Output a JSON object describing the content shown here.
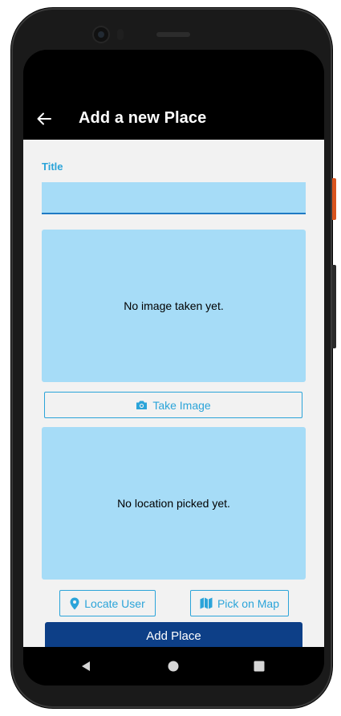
{
  "app_bar": {
    "title": "Add a new Place",
    "back_icon": "arrow-left-icon"
  },
  "form": {
    "title_label": "Title",
    "title_value": "",
    "title_placeholder": ""
  },
  "image_input": {
    "preview_text": "No image taken yet.",
    "take_image_label": "Take Image",
    "take_image_icon": "camera-icon"
  },
  "location_input": {
    "preview_text": "No location picked yet.",
    "locate_user_label": "Locate User",
    "locate_user_icon": "location-pin-icon",
    "pick_on_map_label": "Pick on Map",
    "pick_on_map_icon": "map-icon"
  },
  "submit": {
    "label": "Add Place"
  },
  "system_nav": {
    "back_icon": "nav-back-triangle-icon",
    "home_icon": "nav-home-circle-icon",
    "recents_icon": "nav-recents-square-icon"
  },
  "colors": {
    "accent": "#2ba4d9",
    "input_fill": "#a6dcf7",
    "primary_button": "#0d3f87",
    "background": "#f2f2f2",
    "app_bar": "#000000"
  }
}
